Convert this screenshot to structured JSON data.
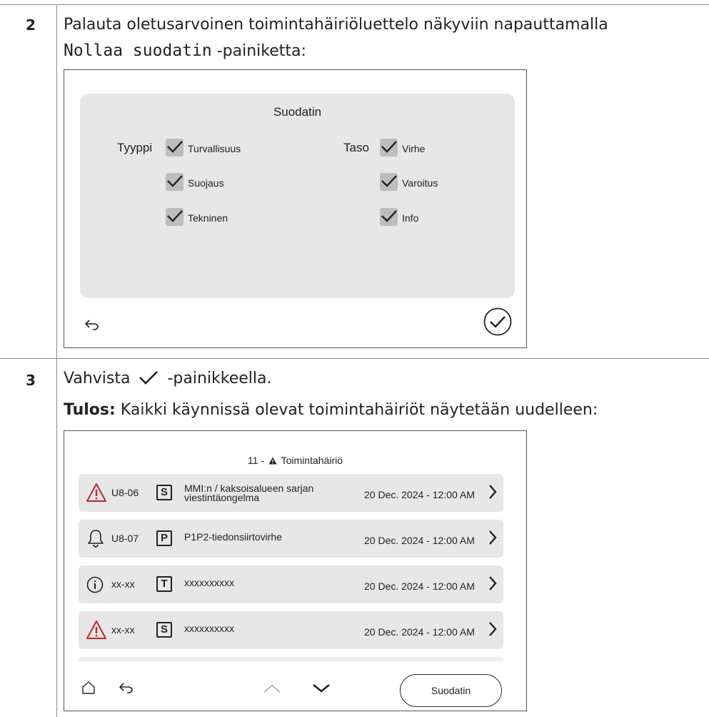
{
  "steps": [
    {
      "number": "2",
      "text_before": "Palauta oletusarvoinen toimintahäiriöluettelo näkyviin napauttamalla",
      "code": "Nollaa suodatin",
      "text_after": "-painiketta:"
    },
    {
      "number": "3",
      "text_before": "Vahvista",
      "text_after": "-painikkeella.",
      "result_label": "Tulos:",
      "result_text": "Kaikki käynnissä olevat toimintahäiriöt näytetään uudelleen:"
    }
  ],
  "filter_screen": {
    "title": "Suodatin",
    "type_label": "Tyyppi",
    "level_label": "Taso",
    "type_options": [
      "Turvallisuus",
      "Suojaus",
      "Tekninen"
    ],
    "level_options": [
      "Virhe",
      "Varoitus",
      "Info"
    ],
    "back_icon": "back-arrow-icon",
    "confirm_icon": "check-circle-icon"
  },
  "malfunction_screen": {
    "title_count": "11 -",
    "title_text": "Toimintahäiriö",
    "rows": [
      {
        "icon": "warning-triangle-icon",
        "code": "U8-06",
        "category": "S",
        "desc_line1": "MMI:n / kaksoisalueen sarjan",
        "desc_line2": "viestintäongelma",
        "date": "20 Dec. 2024 - 12:00 AM"
      },
      {
        "icon": "bell-icon",
        "code": "U8-07",
        "category": "P",
        "desc_line1": "P1P2-tiedonsiirtovirhe",
        "desc_line2": "",
        "date": "20 Dec. 2024 - 12:00 AM"
      },
      {
        "icon": "info-circle-icon",
        "code": "xx-xx",
        "category": "T",
        "desc_line1": "xxxxxxxxxx",
        "desc_line2": "",
        "date": "20 Dec. 2024 - 12:00 AM"
      },
      {
        "icon": "warning-triangle-icon",
        "code": "xx-xx",
        "category": "S",
        "desc_line1": "xxxxxxxxxx",
        "desc_line2": "",
        "date": "20 Dec. 2024 - 12:00 AM"
      }
    ],
    "filter_button_label": "Suodatin",
    "colors": {
      "warning": "#c0262e",
      "panel": "#e7e7e7"
    }
  }
}
